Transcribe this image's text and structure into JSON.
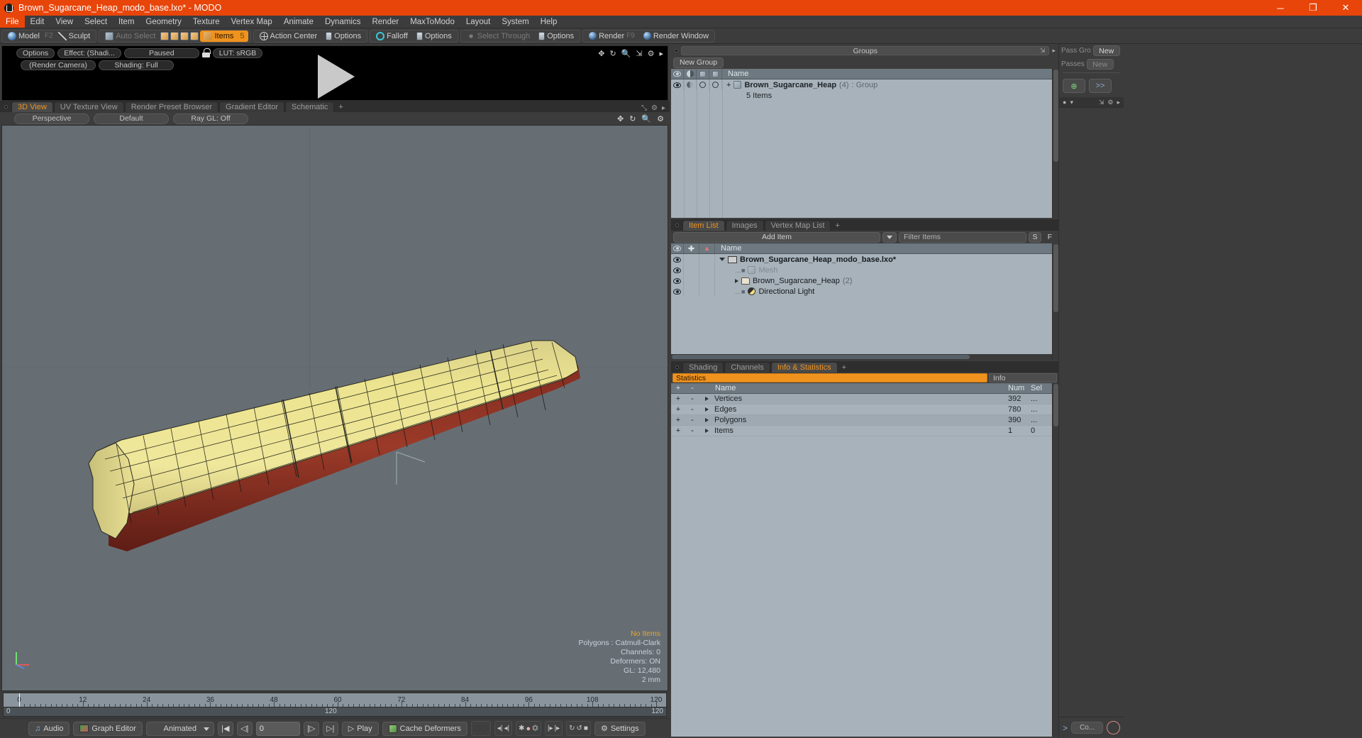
{
  "window": {
    "title": "Brown_Sugarcane_Heap_modo_base.lxo* - MODO",
    "minimize": "─",
    "maximize": "❐",
    "close": "✕"
  },
  "menu": {
    "items": [
      "File",
      "Edit",
      "View",
      "Select",
      "Item",
      "Geometry",
      "Texture",
      "Vertex Map",
      "Animate",
      "Dynamics",
      "Render",
      "MaxToModo",
      "Layout",
      "System",
      "Help"
    ],
    "active": "File"
  },
  "modebar": {
    "model": "Model",
    "model_key": "F2",
    "sculpt": "Sculpt",
    "auto_select": "Auto Select",
    "items": "Items",
    "items_count": "5",
    "action_center": "Action Center",
    "options": "Options",
    "falloff": "Falloff",
    "options2": "Options",
    "select_through": "Select Through",
    "options3": "Options",
    "render": "Render",
    "render_key": "F9",
    "render_window": "Render Window"
  },
  "render_preview": {
    "options": "Options",
    "effect": "Effect: (Shadi...",
    "paused": "Paused",
    "lut": "LUT: sRGB",
    "render_camera": "(Render Camera)",
    "shading": "Shading: Full"
  },
  "viewport_tabs": {
    "tabs": [
      "3D View",
      "UV Texture View",
      "Render Preset Browser",
      "Gradient Editor",
      "Schematic"
    ],
    "active": "3D View",
    "plus": "+"
  },
  "viewport_bar": {
    "perspective": "Perspective",
    "default": "Default",
    "raygl": "Ray GL: Off"
  },
  "viewport_stats": {
    "no_items": "No Items",
    "polygons": "Polygons : Catmull-Clark",
    "channels": "Channels: 0",
    "deformers": "Deformers: ON",
    "gl": "GL: 12,480",
    "scale": "2 mm"
  },
  "timeline": {
    "ticks": [
      "0",
      "12",
      "24",
      "36",
      "48",
      "60",
      "72",
      "84",
      "96",
      "108",
      "120"
    ],
    "range_start": "0",
    "range_mid": "120",
    "range_end": "120",
    "playhead_frame": "0"
  },
  "playbar": {
    "audio": "Audio",
    "graph_editor": "Graph Editor",
    "mode": "Animated",
    "frame_value": "0",
    "play": "Play",
    "cache_deformers": "Cache Deformers",
    "settings": "Settings",
    "go_start": "|◀",
    "step_back": "◁|",
    "step_fwd": "|▷",
    "go_end": "▷|"
  },
  "groups_panel": {
    "title": "Groups",
    "new_group": "New Group",
    "columns": [
      "eye",
      "shade",
      "cube1",
      "cube2",
      "Name"
    ],
    "name_header": "Name",
    "rows": [
      {
        "name": "Brown_Sugarcane_Heap",
        "count": "(4)",
        "type": ": Group",
        "sub": "5 Items",
        "expander": "+"
      }
    ]
  },
  "item_list_panel": {
    "tabs": [
      "Item List",
      "Images",
      "Vertex Map List"
    ],
    "active_tab": "Item List",
    "plus": "+",
    "add_item": "Add Item",
    "filter_placeholder": "Filter Items",
    "btn_s": "S",
    "btn_f": "F",
    "name_header": "Name",
    "rows": [
      {
        "name": "Brown_Sugarcane_Heap_modo_base.lxo*",
        "icon": "scene-icon",
        "indent": 0,
        "expander": "open",
        "bold": true,
        "count": ""
      },
      {
        "name": "Mesh",
        "icon": "mesh-icon",
        "indent": 1,
        "expander": "leaf",
        "bold": false,
        "count": "",
        "dim": true
      },
      {
        "name": "Brown_Sugarcane_Heap",
        "icon": "group-folder-icon",
        "indent": 1,
        "expander": "closed",
        "bold": false,
        "count": "(2)"
      },
      {
        "name": "Directional Light",
        "icon": "light-icon",
        "indent": 1,
        "expander": "leaf",
        "bold": false,
        "count": ""
      }
    ]
  },
  "info_panel": {
    "tabs": [
      "Shading",
      "Channels",
      "Info & Statistics"
    ],
    "active_tab": "Info & Statistics",
    "plus": "+",
    "statistics_label": "Statistics",
    "info_label": "Info",
    "columns": {
      "plus": "+",
      "minus": "-",
      "name": "Name",
      "num": "Num",
      "sel": "Sel"
    },
    "rows": [
      {
        "name": "Vertices",
        "num": "392",
        "sel": "..."
      },
      {
        "name": "Edges",
        "num": "780",
        "sel": "..."
      },
      {
        "name": "Polygons",
        "num": "390",
        "sel": "..."
      },
      {
        "name": "Items",
        "num": "1",
        "sel": "0"
      }
    ]
  },
  "pass_panel": {
    "pass_groups_label": "Pass Gro",
    "pass_groups_new": "New",
    "passes_label": "Passes",
    "passes_new": "New",
    "record_icon": "⊕",
    "forward_icon": ">>",
    "bottom_pill": "Co...",
    "bottom_arrow": ">"
  },
  "colors": {
    "title_bar": "#e8450a",
    "accent": "#f0921e",
    "panel_bg": "#3c3c3c",
    "list_bg": "#a8b2ba",
    "viewport_bg": "#666e74"
  }
}
